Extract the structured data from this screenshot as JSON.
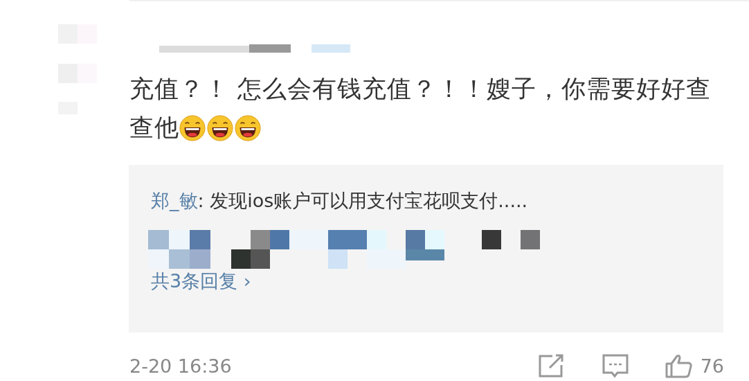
{
  "comment": {
    "text": "充值？！ 怎么会有钱充值？！！嫂子，你需要好好查查他",
    "emojis": [
      {
        "kind": "laugh"
      },
      {
        "kind": "laugh"
      },
      {
        "kind": "laugh"
      }
    ]
  },
  "reply_box": {
    "author": "郑_敏",
    "separator": ":",
    "text": " 发现ios账户可以用支付宝花呗支付.....",
    "more_link": "共3条回复 ›"
  },
  "footer": {
    "time": "2-20 16:36",
    "like_count": "76"
  }
}
